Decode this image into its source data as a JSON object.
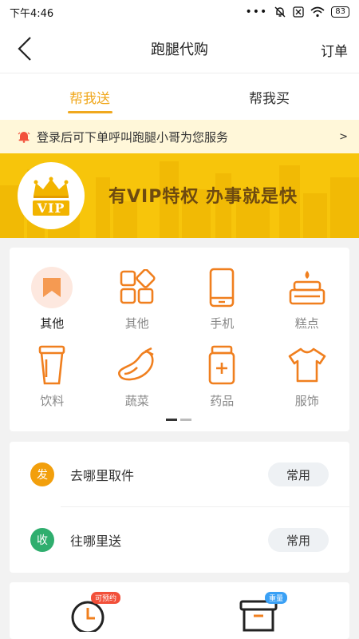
{
  "status_bar": {
    "time": "下午4:46",
    "dots": "•••",
    "battery": "83"
  },
  "nav": {
    "title": "跑腿代购",
    "right": "订单"
  },
  "tabs": [
    {
      "label": "帮我送",
      "active": true
    },
    {
      "label": "帮我买",
      "active": false
    }
  ],
  "notice": {
    "text": "登录后可下单呼叫跑腿小哥为您服务",
    "arrow": ">"
  },
  "vip": {
    "badge": "VIP",
    "slogan": "有VIP特权  办事就是快"
  },
  "categories": [
    {
      "label": "其他",
      "icon": "bookmark-icon",
      "selected": true
    },
    {
      "label": "其他",
      "icon": "grid-icon",
      "selected": false
    },
    {
      "label": "手机",
      "icon": "phone-icon",
      "selected": false
    },
    {
      "label": "糕点",
      "icon": "cake-icon",
      "selected": false
    },
    {
      "label": "饮料",
      "icon": "cup-icon",
      "selected": false
    },
    {
      "label": "蔬菜",
      "icon": "eggplant-icon",
      "selected": false
    },
    {
      "label": "药品",
      "icon": "medicine-icon",
      "selected": false
    },
    {
      "label": "服饰",
      "icon": "tshirt-icon",
      "selected": false
    }
  ],
  "address": {
    "pickup": {
      "badge": "发",
      "text": "去哪里取件",
      "button": "常用"
    },
    "deliver": {
      "badge": "收",
      "text": "往哪里送",
      "button": "常用"
    }
  },
  "bottom": {
    "schedule_tag": "可预约",
    "weight_tag": "重量"
  },
  "colors": {
    "accent": "#f0a81e",
    "banner": "#f7c50b",
    "icon_orange": "#f07f1e"
  }
}
